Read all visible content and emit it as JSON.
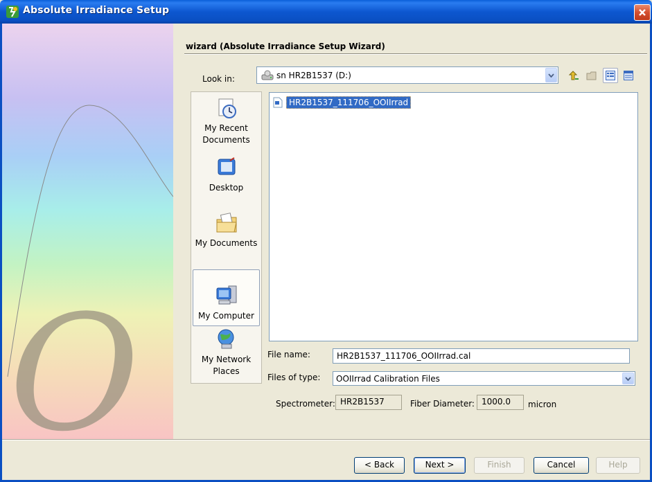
{
  "window": {
    "title": "Absolute Irradiance Setup"
  },
  "wizard": {
    "header": "wizard (Absolute Irradiance Setup Wizard)"
  },
  "look_in": {
    "label": "Look in:",
    "value": "sn  HR2B1537 (D:)"
  },
  "toolbar": {
    "icons": [
      "up-one-level-icon",
      "new-folder-icon",
      "list-view-icon",
      "details-view-icon"
    ]
  },
  "places": [
    {
      "label_1": "My Recent",
      "label_2": "Documents",
      "icon": "recent-documents-icon"
    },
    {
      "label_1": "Desktop",
      "label_2": "",
      "icon": "desktop-icon"
    },
    {
      "label_1": "My Documents",
      "label_2": "",
      "icon": "my-documents-icon"
    },
    {
      "label_1": "My Computer",
      "label_2": "",
      "icon": "my-computer-icon",
      "selected": true
    },
    {
      "label_1": "My Network",
      "label_2": "Places",
      "icon": "network-places-icon"
    }
  ],
  "files": [
    {
      "name": "HR2B1537_111706_OOIIrrad",
      "selected": true
    }
  ],
  "file_name": {
    "label": "File name:",
    "value": "HR2B1537_111706_OOIIrrad.cal"
  },
  "files_of_type": {
    "label": "Files of type:",
    "value": "OOIIrrad Calibration Files"
  },
  "spectrometer": {
    "label": "Spectrometer:",
    "value": "HR2B1537"
  },
  "fiber": {
    "label": "Fiber Diameter:",
    "value": "1000.0",
    "unit": "micron"
  },
  "buttons": {
    "back": "< Back",
    "next": "Next >",
    "finish": "Finish",
    "cancel": "Cancel",
    "help": "Help"
  },
  "colors": {
    "title_bar": "#0a4fc2",
    "selection": "#316ac5",
    "dialog_bg": "#ece9d8"
  }
}
